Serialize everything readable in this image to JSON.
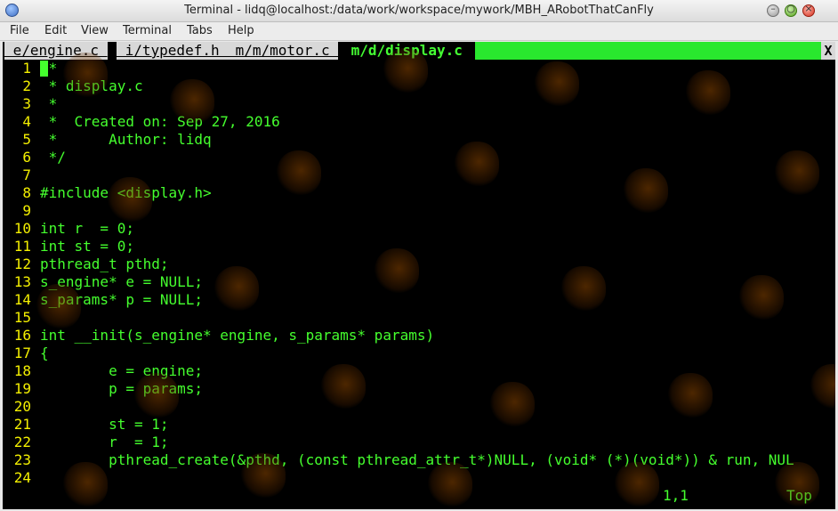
{
  "window": {
    "title": "Terminal - lidq@localhost:/data/work/workspace/mywork/MBH_ARobotThatCanFly",
    "controls": {
      "minimize": "–",
      "maximize": "○",
      "close": "×"
    }
  },
  "menu": [
    "File",
    "Edit",
    "View",
    "Terminal",
    "Tabs",
    "Help"
  ],
  "tabs": [
    {
      "label": " e/engine.c ",
      "active": false
    },
    {
      "label": " i/typedef.h ",
      "active": false
    },
    {
      "label": " m/m/motor.c ",
      "active": false
    },
    {
      "label": " m/d/display.c ",
      "active": true
    }
  ],
  "tab_close": "X",
  "editor": {
    "lines": [
      {
        "no": "1",
        "text": "/*"
      },
      {
        "no": "2",
        "text": " * display.c"
      },
      {
        "no": "3",
        "text": " *"
      },
      {
        "no": "4",
        "text": " *  Created on: Sep 27, 2016"
      },
      {
        "no": "5",
        "text": " *      Author: lidq"
      },
      {
        "no": "6",
        "text": " */"
      },
      {
        "no": "7",
        "text": ""
      },
      {
        "no": "8",
        "text": "#include <display.h>"
      },
      {
        "no": "9",
        "text": ""
      },
      {
        "no": "10",
        "text": "int r  = 0;"
      },
      {
        "no": "11",
        "text": "int st = 0;"
      },
      {
        "no": "12",
        "text": "pthread_t pthd;"
      },
      {
        "no": "13",
        "text": "s_engine* e = NULL;"
      },
      {
        "no": "14",
        "text": "s_params* p = NULL;"
      },
      {
        "no": "15",
        "text": ""
      },
      {
        "no": "16",
        "text": "int __init(s_engine* engine, s_params* params)"
      },
      {
        "no": "17",
        "text": "{"
      },
      {
        "no": "18",
        "text": "        e = engine;"
      },
      {
        "no": "19",
        "text": "        p = params;"
      },
      {
        "no": "20",
        "text": ""
      },
      {
        "no": "21",
        "text": "        st = 1;"
      },
      {
        "no": "22",
        "text": "        r  = 1;"
      },
      {
        "no": "23",
        "text": "        pthread_create(&pthd, (const pthread_attr_t*)NULL, (void* (*)(void*)) & run, NUL"
      },
      {
        "no": "24",
        "text": ""
      }
    ],
    "cursor_position": "1,1",
    "scroll_position": "Top"
  },
  "colors": {
    "terminal_bg": "#000000",
    "code_text": "#45ff2e",
    "line_number": "#f4f000",
    "tab_fill": "#29e82e"
  }
}
